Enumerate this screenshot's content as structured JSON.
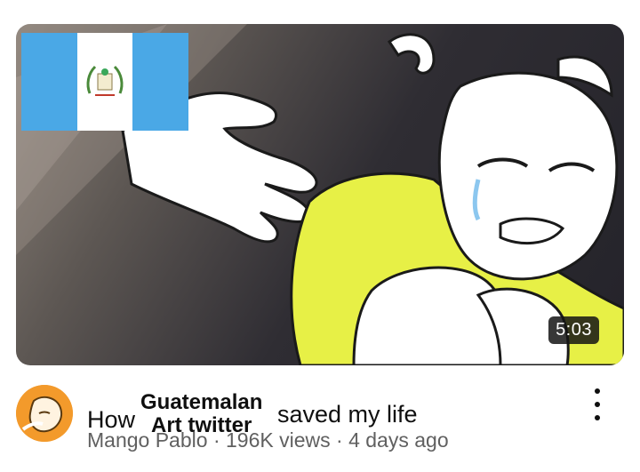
{
  "video": {
    "duration": "5:03",
    "title_prefix": "How",
    "title_overlay_line1": "Guatemalan",
    "title_overlay_line2": "Art twitter",
    "title_suffix": "saved my life",
    "channel": "Mango Pablo",
    "separator": "·",
    "views": "196K views",
    "age": "4 days ago"
  },
  "icons": {
    "more": "more-vert-icon",
    "flag": "guatemala-flag",
    "avatar": "channel-avatar"
  },
  "colors": {
    "flag_blue": "#4aa8e6",
    "shirt_yellow": "#e7f046",
    "avatar_orange": "#f39a2b",
    "text_primary": "#0f0f0f",
    "text_secondary": "#606060"
  }
}
